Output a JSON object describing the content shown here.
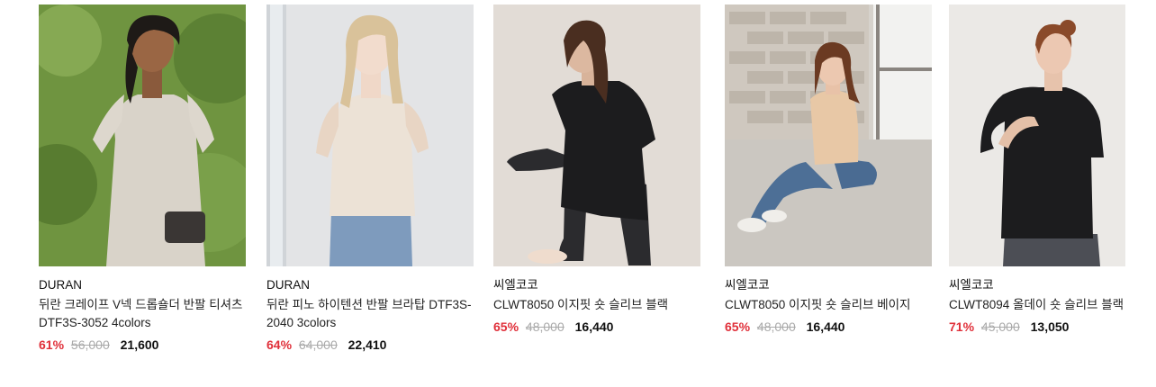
{
  "products": [
    {
      "brand": "DURAN",
      "name": "뒤란 크레이프 V넥 드롭숄더 반팔 티셔츠 DTF3S-3052 4colors",
      "discount": "61%",
      "original_price": "56,000",
      "sale_price": "21,600"
    },
    {
      "brand": "DURAN",
      "name": "뒤란 피노 하이텐션 반팔 브라탑 DTF3S-2040 3colors",
      "discount": "64%",
      "original_price": "64,000",
      "sale_price": "22,410"
    },
    {
      "brand": "씨엘코코",
      "name": "CLWT8050 이지핏 숏 슬리브 블랙",
      "discount": "65%",
      "original_price": "48,000",
      "sale_price": "16,440"
    },
    {
      "brand": "씨엘코코",
      "name": "CLWT8050 이지핏 숏 슬리브 베이지",
      "discount": "65%",
      "original_price": "48,000",
      "sale_price": "16,440"
    },
    {
      "brand": "씨엘코코",
      "name": "CLWT8094 올데이 숏 슬리브 블랙",
      "discount": "71%",
      "original_price": "45,000",
      "sale_price": "13,050"
    }
  ]
}
